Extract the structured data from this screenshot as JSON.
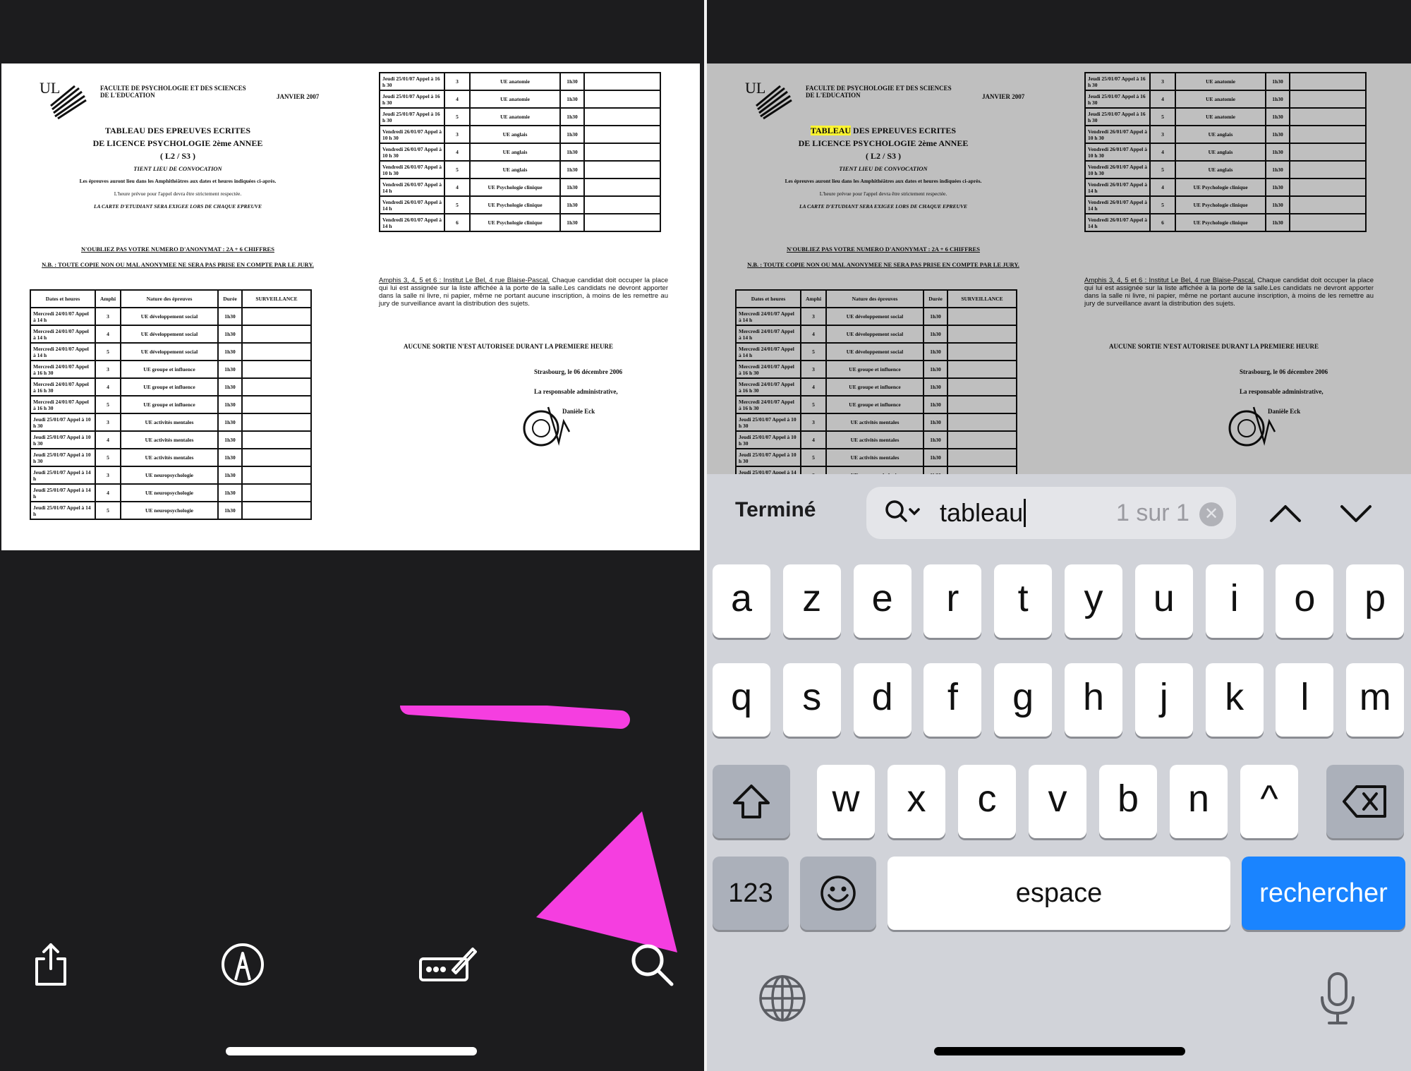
{
  "document": {
    "faculty": "FACULTE DE PSYCHOLOGIE ET DES SCIENCES DE L'EDUCATION",
    "date": "JANVIER 2007",
    "title_line1_rest": "DES EPREUVES ECRITES",
    "title_word": "TABLEAU",
    "title_line2": "DE LICENCE PSYCHOLOGIE 2ème ANNEE",
    "title_line3": "( L2 / S3 )",
    "convocation": "TIENT LIEU DE CONVOCATION",
    "note1": "Les épreuves auront lieu dans les Amphithéâtres aux dates et heures indiquées ci-après.",
    "note2": "L'heure prévue pour l'appel devra être strictement respectée.",
    "note3": "LA CARTE D'ETUDIANT SERA EXIGEE LORS DE CHAQUE EPREUVE",
    "warn1": "N'OUBLIEZ PAS VOTRE NUMERO D'ANONYMAT : 2A + 6 CHIFFRES",
    "warn2": "N.B. : TOUTE COPIE NON OU MAL ANONYMEE NE SERA PAS PRISE EN COMPTE PAR LE JURY.",
    "table_headers": [
      "Dates et heures",
      "Amphi",
      "Nature des épreuves",
      "Durée",
      "SURVEILLANCE"
    ],
    "table_left": [
      [
        "Mercredi 24/01/07 Appel à 14 h",
        "3",
        "UE développement social",
        "1h30"
      ],
      [
        "Mercredi 24/01/07 Appel à 14 h",
        "4",
        "UE développement social",
        "1h30"
      ],
      [
        "Mercredi 24/01/07 Appel à 14 h",
        "5",
        "UE développement social",
        "1h30"
      ],
      [
        "Mercredi 24/01/07 Appel à 16 h 30",
        "3",
        "UE groupe et influence",
        "1h30"
      ],
      [
        "Mercredi 24/01/07 Appel à 16 h 30",
        "4",
        "UE groupe et influence",
        "1h30"
      ],
      [
        "Mercredi 24/01/07 Appel à 16 h 30",
        "5",
        "UE groupe et influence",
        "1h30"
      ],
      [
        "Jeudi 25/01/07 Appel à 10 h 30",
        "3",
        "UE activités mentales",
        "1h30"
      ],
      [
        "Jeudi 25/01/07 Appel à 10 h 30",
        "4",
        "UE activités mentales",
        "1h30"
      ],
      [
        "Jeudi 25/01/07 Appel à 10 h 30",
        "5",
        "UE activités mentales",
        "1h30"
      ],
      [
        "Jeudi 25/01/07 Appel à 14 h",
        "3",
        "UE neuropsychologie",
        "1h30"
      ],
      [
        "Jeudi 25/01/07 Appel à 14 h",
        "4",
        "UE neuropsychologie",
        "1h30"
      ],
      [
        "Jeudi 25/01/07 Appel à 14 h",
        "5",
        "UE neuropsychologie",
        "1h30"
      ]
    ],
    "table_right": [
      [
        "Jeudi 25/01/07 Appel à 16 h 30",
        "3",
        "UE anatomie",
        "1h30"
      ],
      [
        "Jeudi 25/01/07 Appel à 16 h 30",
        "4",
        "UE anatomie",
        "1h30"
      ],
      [
        "Jeudi 25/01/07 Appel à 16 h 30",
        "5",
        "UE anatomie",
        "1h30"
      ],
      [
        "Vendredi 26/01/07 Appel à 10 h 30",
        "3",
        "UE anglais",
        "1h30"
      ],
      [
        "Vendredi 26/01/07 Appel à 10 h 30",
        "4",
        "UE anglais",
        "1h30"
      ],
      [
        "Vendredi 26/01/07 Appel à 10 h 30",
        "5",
        "UE anglais",
        "1h30"
      ],
      [
        "Vendredi 26/01/07 Appel à 14 h",
        "4",
        "UE Psychologie clinique",
        "1h30"
      ],
      [
        "Vendredi 26/01/07 Appel à 14 h",
        "5",
        "UE Psychologie clinique",
        "1h30"
      ],
      [
        "Vendredi 26/01/07 Appel à 14 h",
        "6",
        "UE Psychologie clinique",
        "1h30"
      ]
    ],
    "amphis_label": "Amphis 3, 4, 5 et 6 : Institut Le Bel, 4 rue Blaise-Pascal.",
    "amphis_text": "Chaque candidat doit occuper la place qui lui est assignée sur la liste affichée à la porte de la salle.Les candidats ne devront apporter dans la salle ni livre, ni papier, même ne portant aucune inscription, à moins de les remettre au jury de surveillance avant la distribution des sujets.",
    "no_exit": "AUCUNE SORTIE N'EST AUTORISEE DURANT LA PREMIERE HEURE",
    "place_date": "Strasbourg, le 06 décembre 2006",
    "signatory_role": "La responsable administrative,",
    "signatory_name": "Danièle Eck"
  },
  "left_toolbar": {
    "icons": [
      "share-icon",
      "markup-icon",
      "signature-icon",
      "search-icon"
    ],
    "arrow_color": "#f53ee0"
  },
  "find_bar": {
    "done_label": "Terminé",
    "query": "tableau",
    "match_count": "1 sur 1",
    "highlight_color": "#f6ee34"
  },
  "keyboard": {
    "row1": [
      "a",
      "z",
      "e",
      "r",
      "t",
      "y",
      "u",
      "i",
      "o",
      "p"
    ],
    "row2": [
      "q",
      "s",
      "d",
      "f",
      "g",
      "h",
      "j",
      "k",
      "l",
      "m"
    ],
    "row3": [
      "w",
      "x",
      "c",
      "v",
      "b",
      "n",
      "^"
    ],
    "numbers_label": "123",
    "space_label": "espace",
    "return_label": "rechercher",
    "return_color": "#1a84ff"
  }
}
